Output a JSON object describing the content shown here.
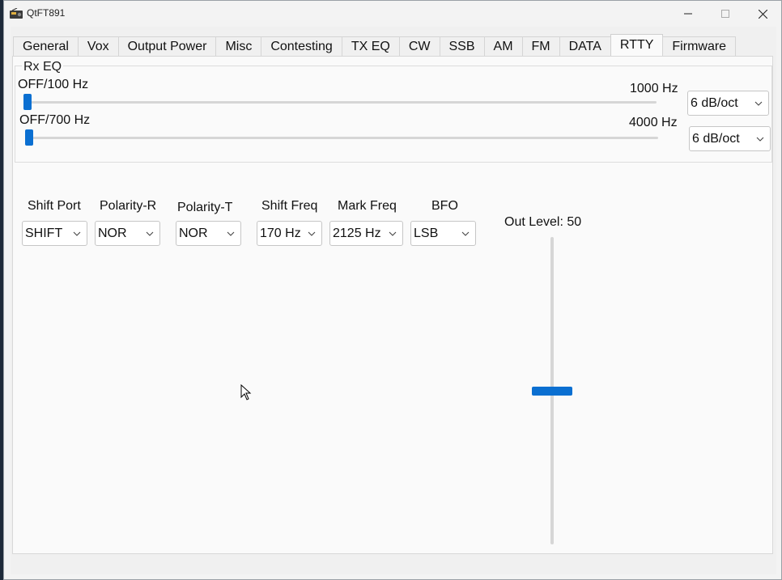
{
  "window": {
    "title": "QtFT891"
  },
  "tabs": [
    "General",
    "Vox",
    "Output Power",
    "Misc",
    "Contesting",
    "TX EQ",
    "CW",
    "SSB",
    "AM",
    "FM",
    "DATA",
    "RTTY",
    "Firmware"
  ],
  "active_tab": "RTTY",
  "rx_eq": {
    "title": "Rx EQ",
    "low": {
      "min_label": "OFF/100 Hz",
      "max_label": "1000 Hz",
      "slope": "6 dB/oct",
      "level": 0
    },
    "high": {
      "min_label": "OFF/700 Hz",
      "max_label": "4000 Hz",
      "slope": "6 dB/oct",
      "level": 0
    }
  },
  "rtty": {
    "shift_port": {
      "label": "Shift Port",
      "value": "SHIFT"
    },
    "polarity_r": {
      "label": "Polarity-R",
      "value": "NOR"
    },
    "polarity_t": {
      "label": "Polarity-T",
      "value": "NOR"
    },
    "shift_freq": {
      "label": "Shift Freq",
      "value": "170 Hz"
    },
    "mark_freq": {
      "label": "Mark Freq",
      "value": "2125 Hz"
    },
    "bfo": {
      "label": "BFO",
      "value": "LSB"
    },
    "out_level": {
      "label": "Out Level: 50",
      "value": 50,
      "min": 0,
      "max": 100
    }
  },
  "colors": {
    "accent": "#0a6fd1",
    "panel": "#fafafa",
    "chrome": "#f0f0f0"
  }
}
